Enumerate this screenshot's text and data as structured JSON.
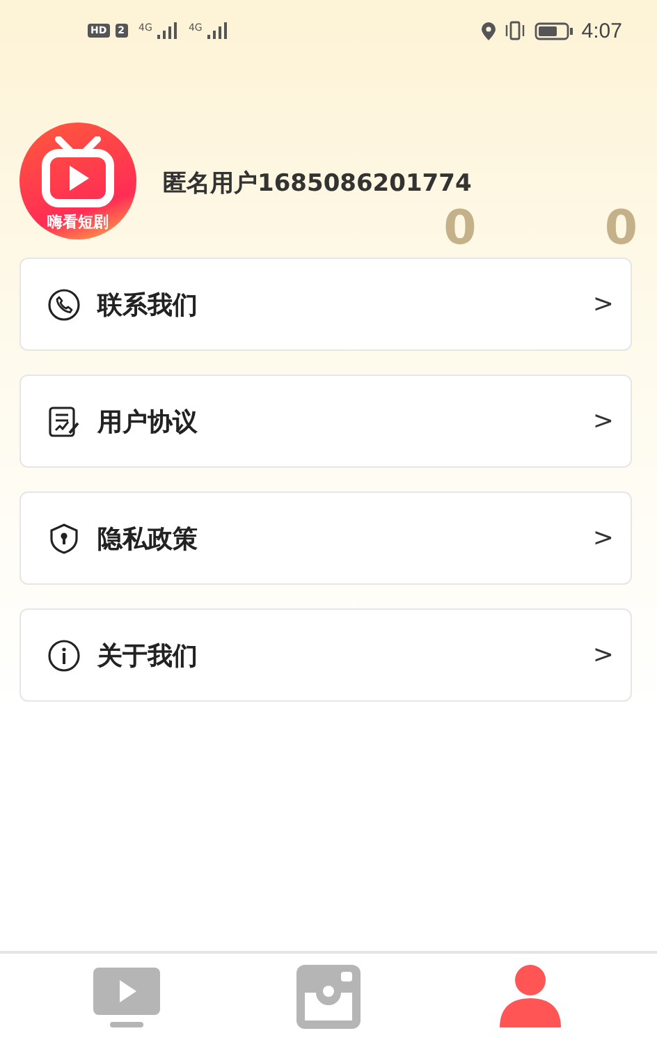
{
  "status_bar": {
    "hd": "HD",
    "sim": "2",
    "network_1": "4G",
    "network_2": "4G",
    "time": "4:07"
  },
  "profile": {
    "logo_text": "嗨看短剧",
    "username": "匿名用户1685086201774",
    "stats": [
      "0",
      "0"
    ]
  },
  "menu": [
    {
      "kind": "phone",
      "label": "联系我们",
      "chevron": ">"
    },
    {
      "kind": "document",
      "label": "用户协议",
      "chevron": ">"
    },
    {
      "kind": "shield",
      "label": "隐私政策",
      "chevron": ">"
    },
    {
      "kind": "info",
      "label": "关于我们",
      "chevron": ">"
    }
  ],
  "tab_bar": [
    {
      "kind": "video",
      "selected": false
    },
    {
      "kind": "camera",
      "selected": false
    },
    {
      "kind": "person",
      "selected": true
    }
  ]
}
